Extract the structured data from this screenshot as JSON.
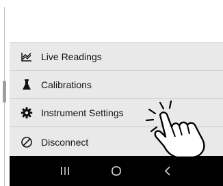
{
  "menu": {
    "items": [
      {
        "label": "Live Readings",
        "icon": "chart-line-icon"
      },
      {
        "label": "Calibrations",
        "icon": "flask-icon"
      },
      {
        "label": "Instrument Settings",
        "icon": "gear-icon"
      },
      {
        "label": "Disconnect",
        "icon": "block-icon"
      }
    ]
  },
  "navbar": {
    "recents_icon": "recents-icon",
    "home_icon": "home-icon",
    "back_icon": "back-icon"
  },
  "overlay": {
    "icon": "tap-hand-icon"
  },
  "colors": {
    "menu_bg": "#e9e9e9",
    "divider": "#c8c8c8",
    "navbar_bg": "#000000",
    "text": "#111111"
  }
}
